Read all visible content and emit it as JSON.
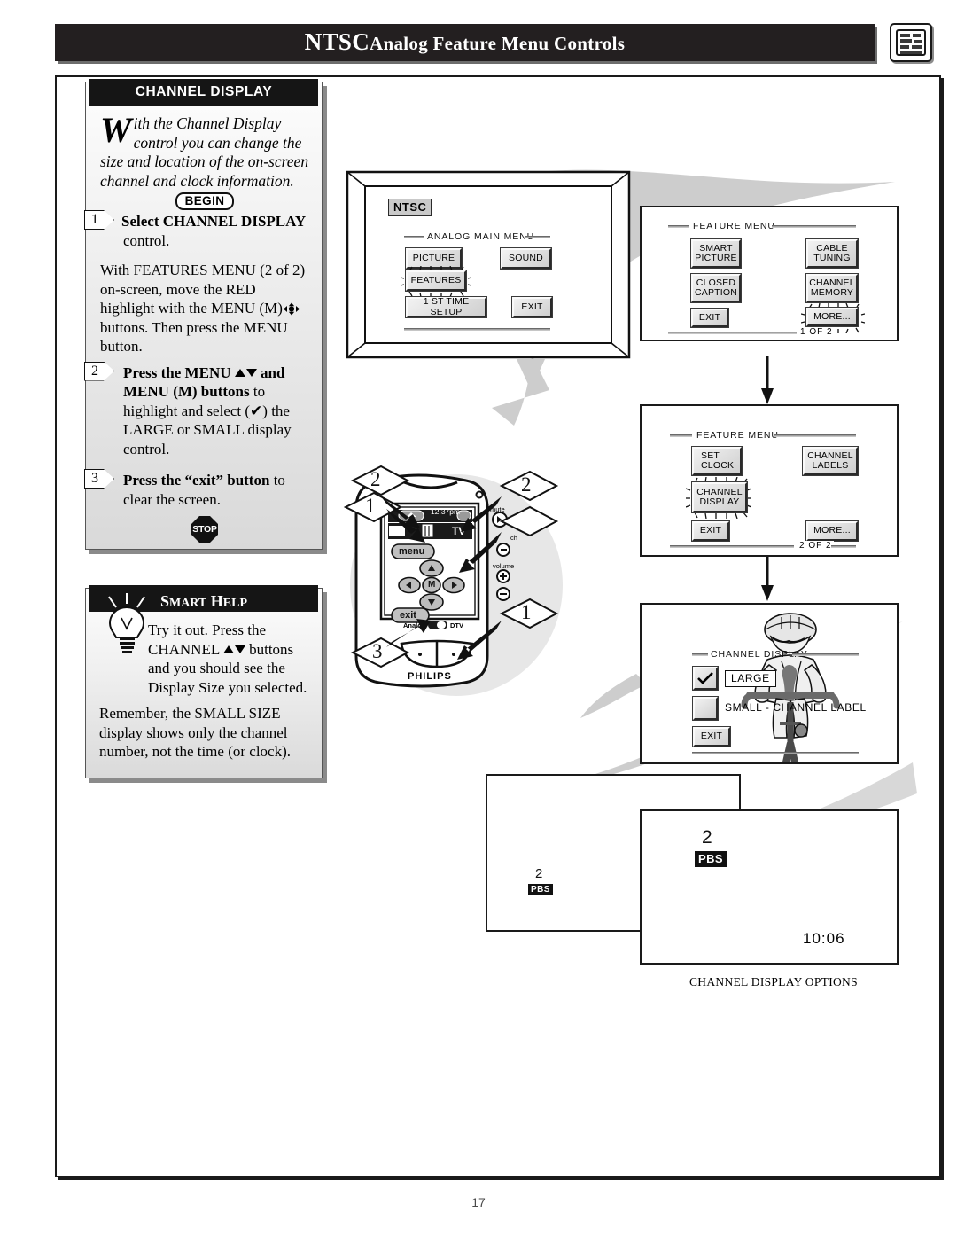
{
  "header": {
    "title_main": "NTSC",
    "title_rest": "Analog Feature Menu Controls",
    "icon_name": "tv-menu-icon"
  },
  "page_number": "17",
  "instruction_panel": {
    "heading": "CHANNEL DISPLAY",
    "dropcap": "W",
    "intro": "ith the Channel Display control you can change the size and location of the on-screen channel and clock information.",
    "begin_label": "BEGIN",
    "stop_label": "STOP",
    "steps": [
      {
        "number": "1",
        "bold": "Select CHANNEL DISPLAY",
        "rest": " control.",
        "body": "With FEATURES MENU (2 of 2) on-screen, move the RED highlight with the MENU (M)",
        "body_after": " buttons. Then press the MENU button."
      },
      {
        "number": "2",
        "bold_a": "Press the MENU ",
        "bold_b": " and MENU (M) buttons",
        "rest": " to highlight and select (✔) the LARGE or SMALL display control."
      },
      {
        "number": "3",
        "bold": "Press the “exit” button",
        "rest": " to clear the screen."
      }
    ]
  },
  "smart_help": {
    "heading": "Smart Help",
    "heading_caps": "S",
    "heading_caps2": "H",
    "icon_name": "lightbulb-icon",
    "para1_a": "Try it out.  Press the CHANNEL ",
    "para1_b": " buttons and you should see the Display Size you selected.",
    "para2": "Remember, the SMALL SIZE display shows only the channel number, not the time (or clock)."
  },
  "tv_main_menu": {
    "ntsc_tag": "NTSC",
    "menu_title": "ANALOG MAIN MENU",
    "buttons": [
      {
        "label": "PICTURE",
        "highlighted": false
      },
      {
        "label": "SOUND",
        "highlighted": false
      },
      {
        "label": "FEATURES",
        "highlighted": true
      },
      {
        "label": "1 ST TIME SETUP",
        "highlighted": false
      },
      {
        "label": "EXIT",
        "highlighted": false
      }
    ]
  },
  "feature_menu_1": {
    "title": "FEATURE MENU",
    "page_label": "1 OF 2",
    "buttons": [
      {
        "line1": "SMART",
        "line2": "PICTURE",
        "highlighted": false
      },
      {
        "line1": "CABLE",
        "line2": "TUNING",
        "highlighted": false
      },
      {
        "line1": "CLOSED",
        "line2": "CAPTION",
        "highlighted": false
      },
      {
        "line1": "CHANNEL",
        "line2": "MEMORY",
        "highlighted": false
      },
      {
        "line1": "EXIT",
        "line2": "",
        "highlighted": false
      },
      {
        "line1": "MORE...",
        "line2": "",
        "highlighted": true
      }
    ]
  },
  "feature_menu_2": {
    "title": "FEATURE MENU",
    "page_label": "2 OF 2",
    "buttons": [
      {
        "line1": "SET",
        "line2": "CLOCK",
        "highlighted": false
      },
      {
        "line1": "CHANNEL",
        "line2": "LABELS",
        "highlighted": false
      },
      {
        "line1": "CHANNEL",
        "line2": "DISPLAY",
        "highlighted": true
      },
      {
        "line1": "EXIT",
        "line2": "",
        "highlighted": false
      },
      {
        "line1": "MORE...",
        "line2": "",
        "highlighted": false
      }
    ]
  },
  "channel_display_menu": {
    "title": "CHANNEL DISPLAY",
    "option_large": "LARGE",
    "option_large_checked": true,
    "option_small": "SMALL - CHANNEL LABEL",
    "option_small_checked": false,
    "exit_label": "EXIT",
    "background_image": "cyclist-illustration"
  },
  "channel_display_options": {
    "caption": "CHANNEL DISPLAY OPTIONS",
    "small_example": {
      "channel": "2",
      "label": "PBS"
    },
    "large_example": {
      "channel": "2",
      "label": "PBS",
      "clock": "10:06"
    }
  },
  "remote": {
    "brand": "PHILIPS",
    "clock": "12:37pm",
    "tv_label": "TV",
    "menu_button": "menu",
    "exit_button": "exit",
    "m_button": "M",
    "mute_label": "mute",
    "ch_label": "ch",
    "volume_label": "volume",
    "mode_left": "Analog",
    "mode_right": "DTV",
    "callouts": [
      "2",
      "1",
      "2",
      "1",
      "3"
    ]
  },
  "colors": {
    "header_bg": "#231f20",
    "panel_bg": "#e8e8e8",
    "swoosh_gray": "#cfcfcf",
    "osd_button": "#d5d5d5"
  }
}
